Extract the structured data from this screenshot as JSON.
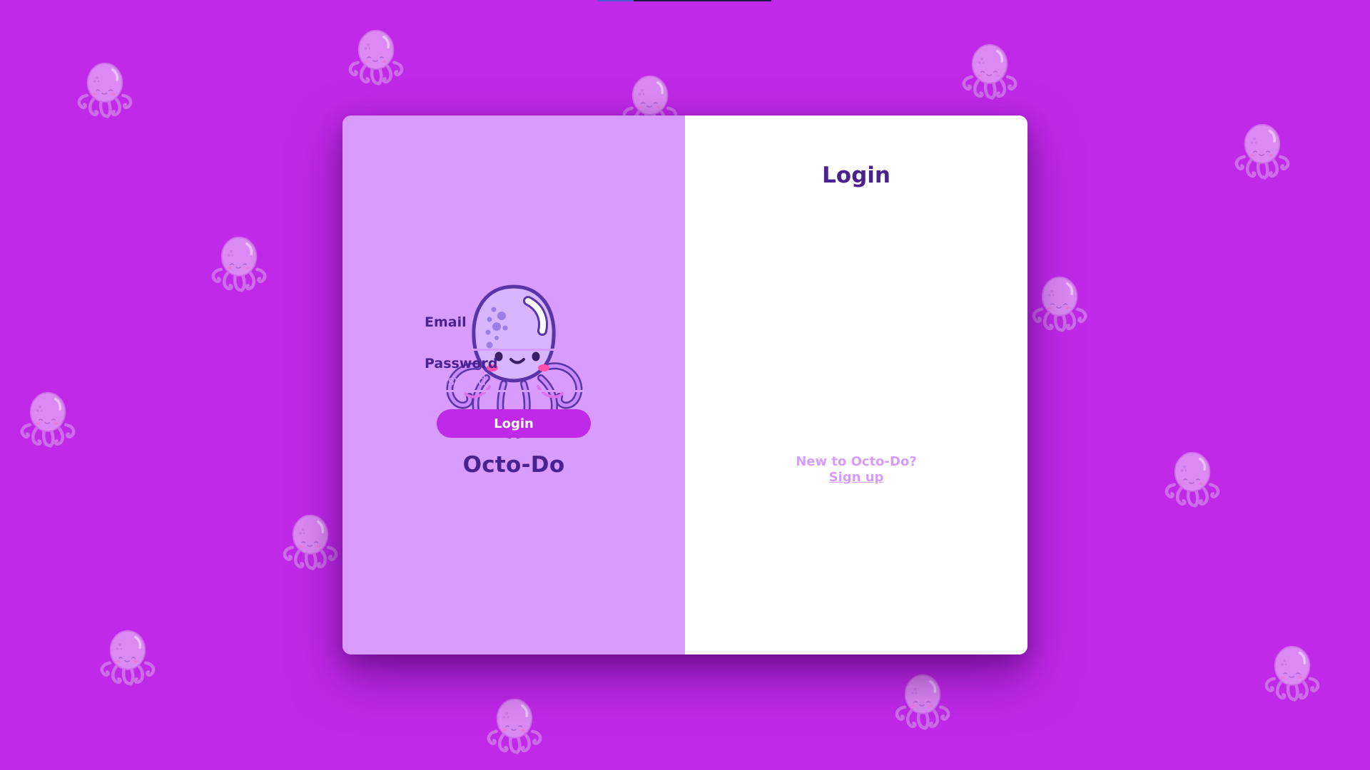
{
  "brand": {
    "name": "Octo-Do",
    "logo_icon": "octopus-icon",
    "background_icon": "octopus-icon"
  },
  "login": {
    "title": "Login",
    "email_label": "Email",
    "email_placeholder": "Email",
    "email_value": "",
    "password_label": "Password",
    "password_placeholder": "Password",
    "password_value": "",
    "button_label": "Login",
    "new_user_text": "New to Octo-Do?",
    "signup_link": "Sign up"
  },
  "colors": {
    "background": "#c029e8",
    "left_panel": "#d89cff",
    "right_panel": "#ffffff",
    "heading_text": "#4a2290",
    "accent": "#c029e8",
    "muted_accent": "#d89cff"
  }
}
